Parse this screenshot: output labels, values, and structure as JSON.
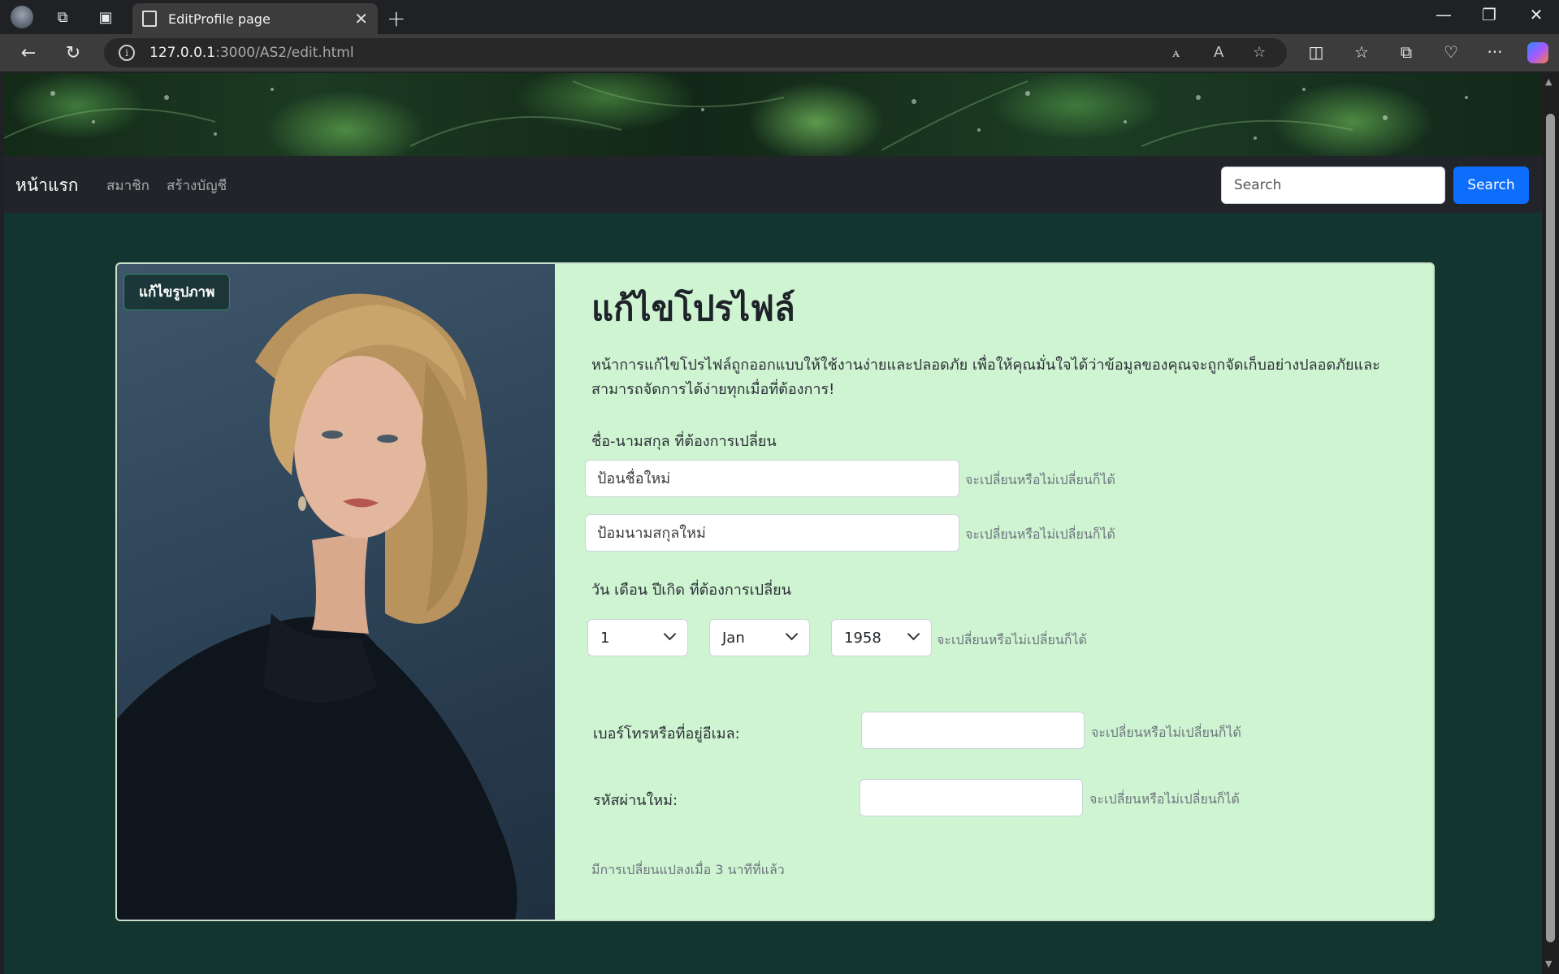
{
  "browser": {
    "tab_title": "EditProfile page",
    "url_host": "127.0.0.1",
    "url_path": ":3000/AS2/edit.html"
  },
  "navbar": {
    "brand": "หน้าแรก",
    "links": [
      "สมาชิก",
      "สร้างบัญชี"
    ],
    "search_placeholder": "Search",
    "search_button": "Search"
  },
  "card": {
    "edit_picture_button": "แก้ไขรูปภาพ",
    "title": "แก้ไขโปรไฟล์",
    "description": "หน้าการแก้ไขโปรไฟล์ถูกออกแบบให้ใช้งานง่ายและปลอดภัย เพื่อให้คุณมั่นใจได้ว่าข้อมูลของคุณจะถูกจัดเก็บอย่างปลอดภัยและสามารถจัดการได้ง่ายทุกเมื่อที่ต้องการ!",
    "name_section_label": "ชื่อ-นามสกุล ที่ต้องการเปลี่ยน",
    "first_name_placeholder": "ป้อนชื่อใหม่",
    "last_name_placeholder": "ป้อมนามสกุลใหม่",
    "optional_hint": "จะเปลี่ยนหรือไม่เปลี่ยนก็ได้",
    "birth_section_label": "วัน เดือน ปีเกิด ที่ต้องการเปลี่ยน",
    "birth_day": "1",
    "birth_month": "Jan",
    "birth_year": "1958",
    "contact_label": "เบอร์โทรหรือที่อยู่อีเมล:",
    "password_label": "รหัสผ่านใหม่:",
    "last_updated": "มีการเปลี่ยนแปลงเมื่อ 3 นาทีที่แล้ว"
  }
}
